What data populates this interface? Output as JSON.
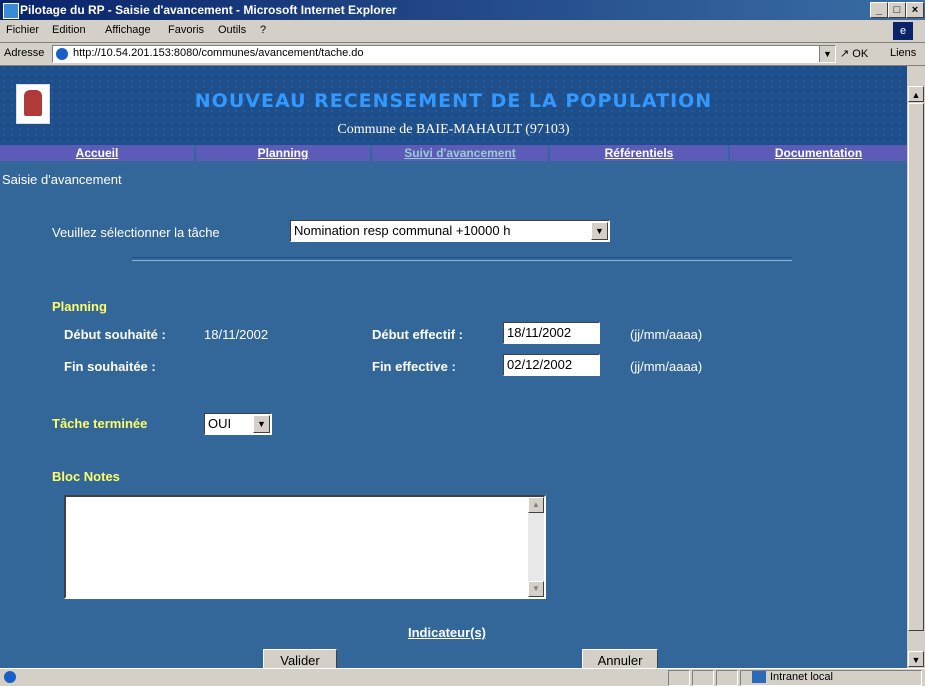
{
  "window": {
    "title": "Pilotage du RP - Saisie d'avancement - Microsoft Internet Explorer",
    "min": "_",
    "max": "□",
    "close": "×"
  },
  "menu": [
    "Fichier",
    "Edition",
    "Affichage",
    "Favoris",
    "Outils",
    "?"
  ],
  "address": {
    "label": "Adresse",
    "url": "http://10.54.201.153:8080/communes/avancement/tache.do",
    "go": "OK",
    "links": "Liens"
  },
  "banner": {
    "title": "NOUVEAU RECENSEMENT DE LA POPULATION",
    "subtitle": "Commune de BAIE-MAHAULT (97103)"
  },
  "nav": [
    "Accueil",
    "Planning",
    "Suivi d'avancement",
    "Référentiels",
    "Documentation"
  ],
  "page": {
    "title": "Saisie d'avancement",
    "task_label": "Veuillez sélectionner la tâche",
    "task_value": "Nomination resp communal +10000 h",
    "planning_heading": "Planning",
    "debut_souhaite_label": "Début souhaité :",
    "debut_souhaite_value": "18/11/2002",
    "fin_souhaitee_label": "Fin souhaitée :",
    "debut_effectif_label": "Début effectif :",
    "debut_effectif_value": "18/11/2002",
    "fin_effective_label": "Fin effective :",
    "fin_effective_value": "02/12/2002",
    "date_format": "(jj/mm/aaaa)",
    "tache_terminee_label": "Tâche terminée",
    "tache_terminee_value": "OUI",
    "bloc_notes_label": "Bloc Notes",
    "indicateurs": "Indicateur(s)",
    "valider": "Valider",
    "annuler": "Annuler"
  },
  "status": {
    "zone": "Intranet local"
  }
}
